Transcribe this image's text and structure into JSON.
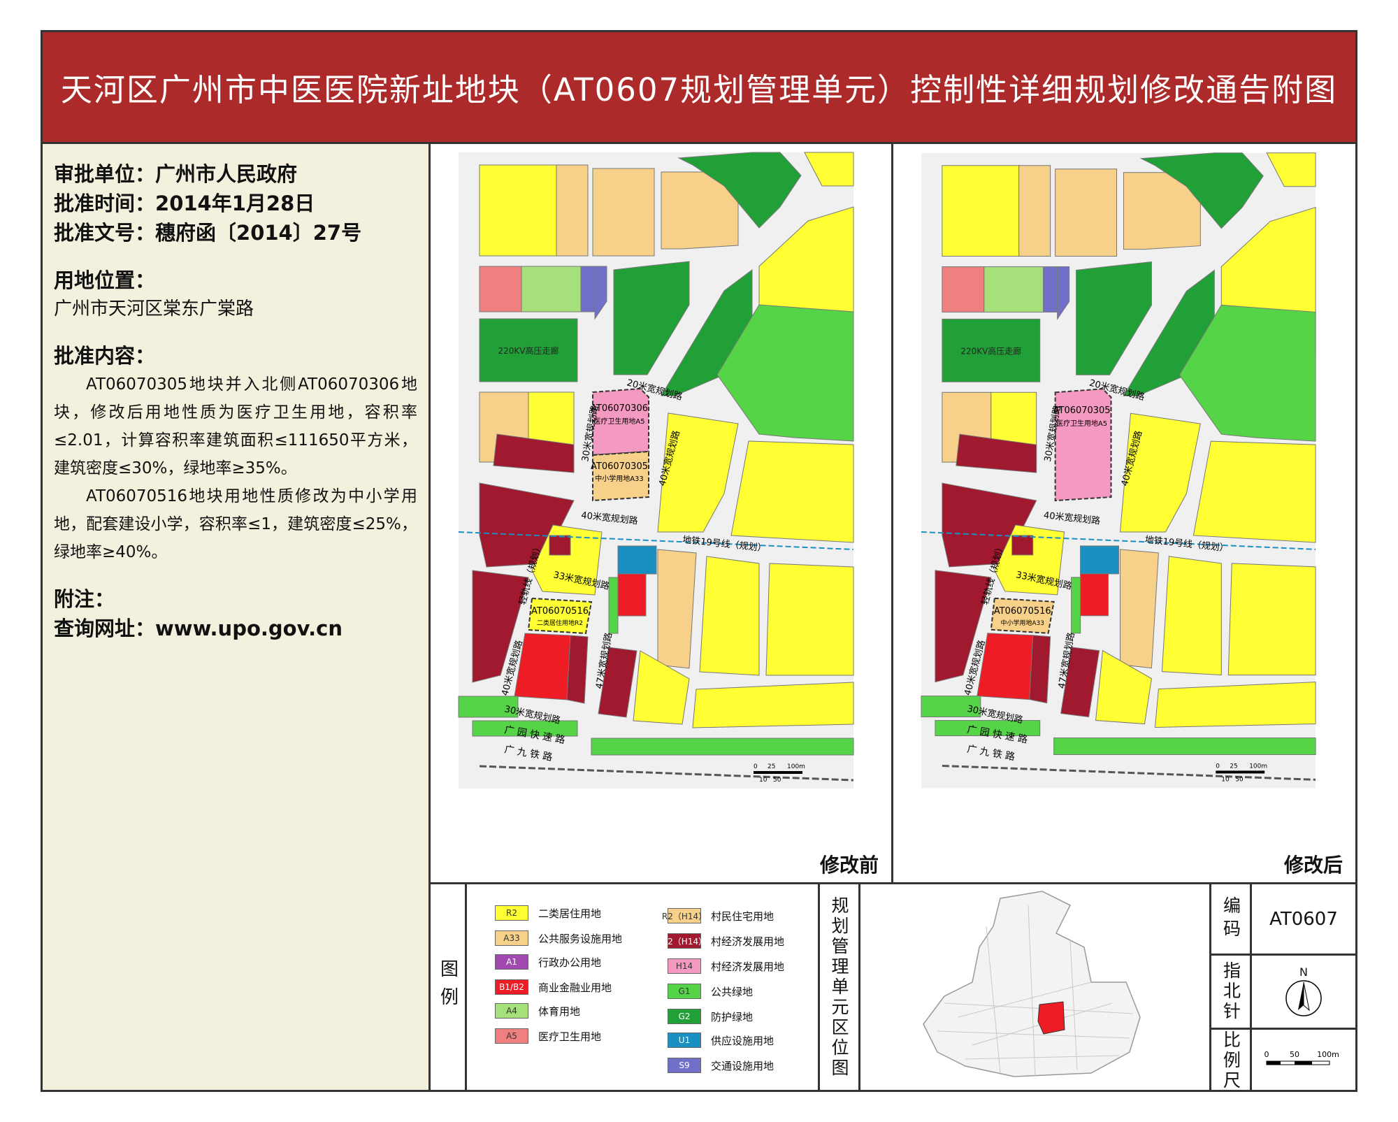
{
  "title": "天河区广州市中医医院新址地块（AT0607规划管理单元）控制性详细规划修改通告附图",
  "info": {
    "approval_unit_label": "审批单位：",
    "approval_unit": "广州市人民政府",
    "approval_time_label": "批准时间：",
    "approval_time": "2014年1月28日",
    "approval_doc_label": "批准文号：",
    "approval_doc": "穗府函〔2014〕27号",
    "location_label": "用地位置：",
    "location": "广州市天河区棠东广棠路",
    "content_label": "批准内容：",
    "content_p1": "AT06070305地块并入北侧AT06070306地块，修改后用地性质为医疗卫生用地，容积率≤2.01，计算容积率建筑面积≤111650平方米，建筑密度≤30%，绿地率≥35%。",
    "content_p2": "AT06070516地块用地性质修改为中小学用地，配套建设小学，容积率≤1，建筑密度≤25%，绿地率≥40%。",
    "note_label": "附注：",
    "website_label": "查询网址：",
    "website": "www.upo.gov.cn"
  },
  "maps": {
    "before_label": "修改前",
    "after_label": "修改后",
    "before": {
      "parcel_a_code": "AT06070306",
      "parcel_a_use": "医疗卫生用地A5",
      "parcel_b_code": "AT06070305",
      "parcel_b_use": "中小学用地A33",
      "parcel_c_code": "AT06070516",
      "parcel_c_use": "二类居住用地R2"
    },
    "after": {
      "parcel_a_code": "AT06070305",
      "parcel_a_use": "医疗卫生用地A5",
      "parcel_c_code": "AT06070516",
      "parcel_c_use": "中小学用地A33"
    },
    "roads": {
      "r20": "20米宽规划路",
      "r30v": "30米宽规划路",
      "r40a": "40米宽规划路",
      "r40b": "40米宽规划路",
      "r33": "33米宽规划路",
      "r40c": "40米宽规划路",
      "r47": "47米宽规划路",
      "r30h": "30米宽规划路",
      "metro": "地铁19号线（规划）",
      "lrt": "轻轨线（规划）",
      "expressway": "广 园 快 速 路",
      "railway": "广 九 铁 路",
      "corridor": "220KV高压走廊"
    },
    "scale_labels": [
      "0",
      "25",
      "100m",
      "10",
      "50"
    ]
  },
  "legend_title": "图例",
  "legend": [
    {
      "code": "R2",
      "name": "二类居住用地",
      "color": "#ffff33"
    },
    {
      "code": "A33",
      "name": "公共服务设施用地",
      "color": "#f7d08a"
    },
    {
      "code": "A1",
      "name": "行政办公用地",
      "color": "#a04ab0"
    },
    {
      "code": "B1/B2",
      "name": "商业金融业用地",
      "color": "#ee1c24"
    },
    {
      "code": "A4",
      "name": "体育用地",
      "color": "#a6e07a"
    },
    {
      "code": "A5",
      "name": "医疗卫生用地",
      "color": "#f08080"
    },
    {
      "code": "R2（H14）",
      "name": "村民住宅用地",
      "color": "#f7d08a"
    },
    {
      "code": "B2（H14）",
      "name": "村经济发展用地",
      "color": "#a0192e"
    },
    {
      "code": "H14",
      "name": "村经济发展用地",
      "color": "#f49ac1"
    },
    {
      "code": "G1",
      "name": "公共绿地",
      "color": "#55d447"
    },
    {
      "code": "G2",
      "name": "防护绿地",
      "color": "#22a038"
    },
    {
      "code": "U1",
      "name": "供应设施用地",
      "color": "#1a8fc2"
    },
    {
      "code": "S9",
      "name": "交通设施用地",
      "color": "#7070c8"
    }
  ],
  "location_map_title": "规划管理单元区位图",
  "code_label": "编码",
  "code_value": "AT0607",
  "north_label": "指北针",
  "north_letter": "N",
  "scale_label": "比例尺",
  "scale_ticks": [
    "0",
    "50",
    "100m"
  ]
}
